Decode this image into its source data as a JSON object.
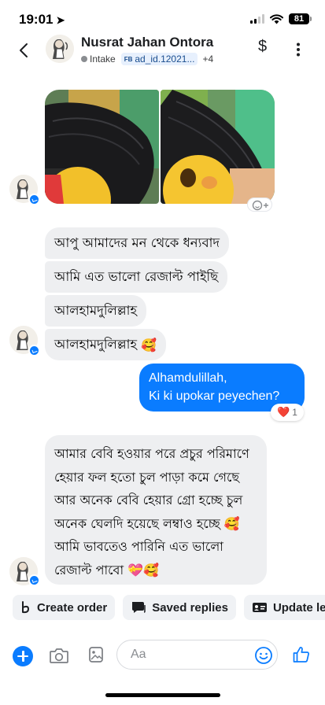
{
  "status_bar": {
    "time": "19:01",
    "battery": "81"
  },
  "header": {
    "contact_name": "Nusrat Jahan Ontora",
    "status_label": "Intake",
    "ad_chip_prefix": "FB",
    "ad_chip": "ad_id.12021...",
    "extra_count": "+4",
    "dollar": "$"
  },
  "messages": {
    "incoming_1": "আপু আমাদের মন থেকে ধন্যবাদ",
    "incoming_2": "আমি এত ভালো রেজাল্ট পাইছি",
    "incoming_3": "আলহামদুলিল্লাহ",
    "incoming_4": "আলহামদুলিল্লাহ",
    "incoming_4_emoji": "🥰",
    "outgoing_line1": "Alhamdulillah,",
    "outgoing_line2": "Ki ki upokar peyechen?",
    "outgoing_reaction_emoji": "❤️",
    "outgoing_reaction_count": "1",
    "long_message_lines": [
      "আমার বেবি হওয়ার পরে প্রচুর পরিমাণে",
      "হেয়ার ফল হতো চুল পাড়া কমে গেছে",
      "আর অনেক বেবি হেয়ার গ্রো হচ্ছে চুল",
      "অনেক ঘেলদি হয়েছে লম্বাও হচ্ছে",
      "আমি ভাবতেও পারিনি এত ভালো",
      "রেজাল্ট পাবো"
    ],
    "long_line4_emoji": "🥰",
    "long_line6_emoji": "💝🥰"
  },
  "quick_actions": {
    "create_order": "Create order",
    "saved_replies": "Saved replies",
    "update_lead": "Update le"
  },
  "composer": {
    "placeholder": "Aa"
  },
  "colors": {
    "accent": "#0a7cff",
    "incoming_bubble": "#eeeff1",
    "chip_bg": "#f0f2f5"
  }
}
